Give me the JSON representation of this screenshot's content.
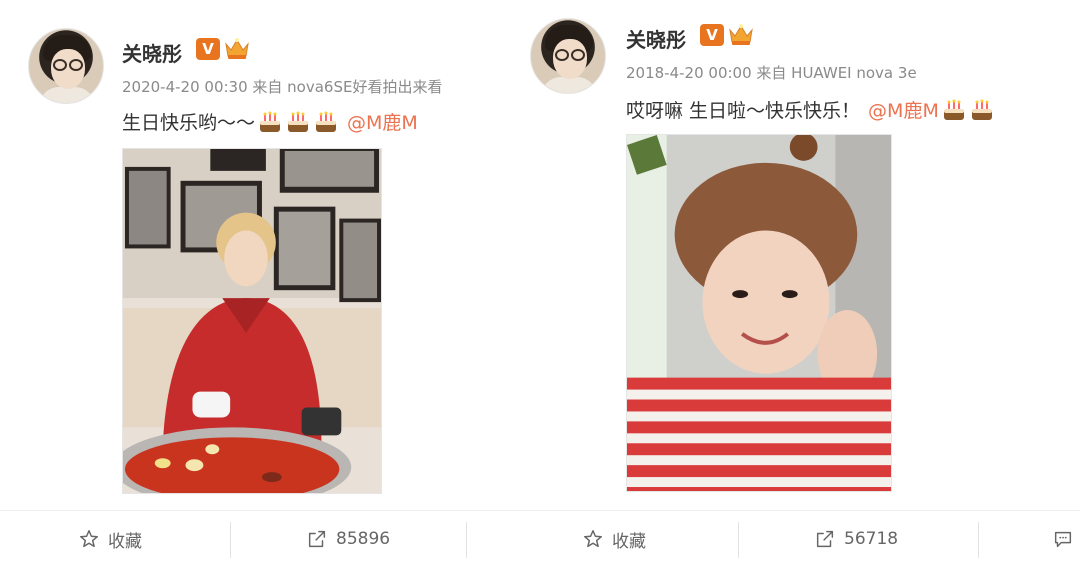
{
  "posts": [
    {
      "username": "关晓彤",
      "badge": "V",
      "timestamp": "2020-4-20 00:30",
      "source": "来自 nova6SE好看拍出来看",
      "text": "生日快乐哟～～",
      "cakes": 3,
      "mention": "@M鹿M",
      "photo_icon": "photo-red-hoodie-hotpot",
      "footer": {
        "favorite_label": "收藏",
        "share_count": "85896"
      }
    },
    {
      "username": "关晓彤",
      "badge": "V",
      "timestamp": "2018-4-20 00:00",
      "source": "来自 HUAWEI nova 3e",
      "text": "哎呀嘛 生日啦～快乐快乐！",
      "cakes": 2,
      "mention": "@M鹿M",
      "photo_icon": "photo-striped-shirt-selfie",
      "footer": {
        "favorite_label": "收藏",
        "share_count": "56718"
      }
    }
  ],
  "colors": {
    "text": "#333333",
    "meta": "#8a8a8a",
    "mention": "#eb7350",
    "badge": "#e8741f"
  }
}
